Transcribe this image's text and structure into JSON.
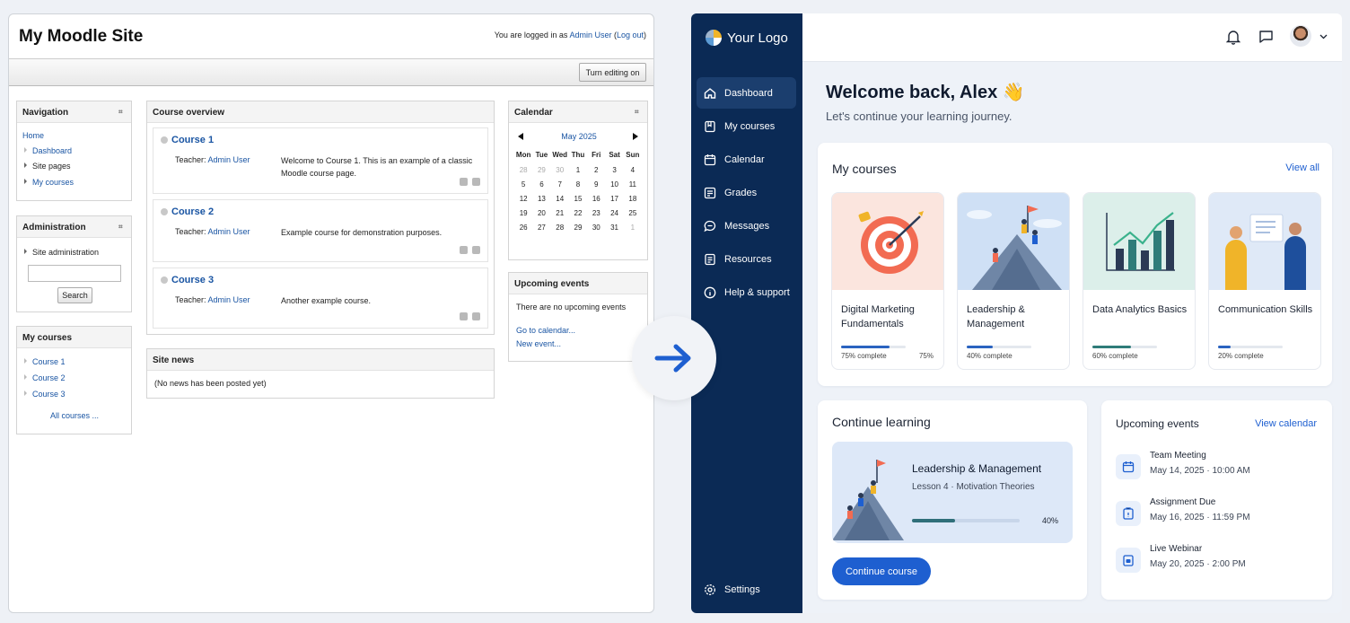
{
  "old": {
    "site_title": "My Moodle Site",
    "login_prefix": "You are logged in as ",
    "login_user": "Admin User",
    "login_open": " (",
    "logout": "Log out",
    "login_close": ")",
    "edit_button": "Turn editing on",
    "navigation": {
      "title": "Navigation",
      "home": "Home",
      "items": [
        "Dashboard",
        "Site pages",
        "My courses"
      ]
    },
    "administration": {
      "title": "Administration",
      "item": "Site administration",
      "search_button": "Search"
    },
    "my_courses": {
      "title": "My courses",
      "items": [
        "Course 1",
        "Course 2",
        "Course 3"
      ],
      "all": "All courses ..."
    },
    "overview": {
      "title": "Course overview",
      "teacher_label": "Teacher: ",
      "courses": [
        {
          "name": "Course 1",
          "teacher": "Admin User",
          "desc": "Welcome to Course 1. This is an example of a classic Moodle course page."
        },
        {
          "name": "Course 2",
          "teacher": "Admin User",
          "desc": "Example course for demonstration purposes."
        },
        {
          "name": "Course 3",
          "teacher": "Admin User",
          "desc": "Another example course."
        }
      ]
    },
    "site_news": {
      "title": "Site news",
      "text": "(No news has been posted yet)"
    },
    "calendar": {
      "title": "Calendar",
      "month": "May 2025",
      "days": [
        "Mon",
        "Tue",
        "Wed",
        "Thu",
        "Fri",
        "Sat",
        "Sun"
      ],
      "weeks": [
        [
          "28",
          "29",
          "30",
          "1",
          "2",
          "3",
          "4"
        ],
        [
          "5",
          "6",
          "7",
          "8",
          "9",
          "10",
          "11"
        ],
        [
          "12",
          "13",
          "14",
          "15",
          "16",
          "17",
          "18"
        ],
        [
          "19",
          "20",
          "21",
          "22",
          "23",
          "24",
          "25"
        ],
        [
          "26",
          "27",
          "28",
          "29",
          "30",
          "31",
          "1"
        ]
      ]
    },
    "upcoming": {
      "title": "Upcoming events",
      "text": "There are no upcoming events",
      "go": "Go to calendar...",
      "new": "New event..."
    }
  },
  "new": {
    "logo": "Your Logo",
    "nav": [
      {
        "label": "Dashboard",
        "icon": "home-icon"
      },
      {
        "label": "My courses",
        "icon": "book-icon"
      },
      {
        "label": "Calendar",
        "icon": "calendar-icon"
      },
      {
        "label": "Grades",
        "icon": "grades-icon"
      },
      {
        "label": "Messages",
        "icon": "message-icon"
      },
      {
        "label": "Resources",
        "icon": "folder-icon"
      },
      {
        "label": "Help & support",
        "icon": "help-icon"
      }
    ],
    "settings": "Settings",
    "welcome": "Welcome back, Alex 👋",
    "subtitle": "Let's continue your learning journey.",
    "my_courses": {
      "title": "My courses",
      "view_all": "View all",
      "courses": [
        {
          "name": "Digital Marketing Fundamentals",
          "progress": 75,
          "pct_label": "75% complete",
          "right_label": "75%"
        },
        {
          "name": "Leadership & Management",
          "progress": 40,
          "pct_label": "40% complete",
          "right_label": ""
        },
        {
          "name": "Data Analytics Basics",
          "progress": 60,
          "pct_label": "60% complete",
          "right_label": ""
        },
        {
          "name": "Communication Skills",
          "progress": 20,
          "pct_label": "20% complete",
          "right_label": ""
        }
      ]
    },
    "continue": {
      "title": "Continue learning",
      "course": "Leadership & Management",
      "lesson": "Lesson 4 · Motivation Theories",
      "progress": 40,
      "pct": "40%",
      "button": "Continue course"
    },
    "events": {
      "title": "Upcoming events",
      "view": "View calendar",
      "items": [
        {
          "name": "Team Meeting",
          "date": "May 14, 2025 · 10:00 AM"
        },
        {
          "name": "Assignment Due",
          "date": "May 16, 2025 · 11:59 PM"
        },
        {
          "name": "Live Webinar",
          "date": "May 20, 2025 · 2:00 PM"
        }
      ]
    },
    "colors": {
      "sidebar": "#0b2a55",
      "accent": "#1e5fd0"
    }
  }
}
